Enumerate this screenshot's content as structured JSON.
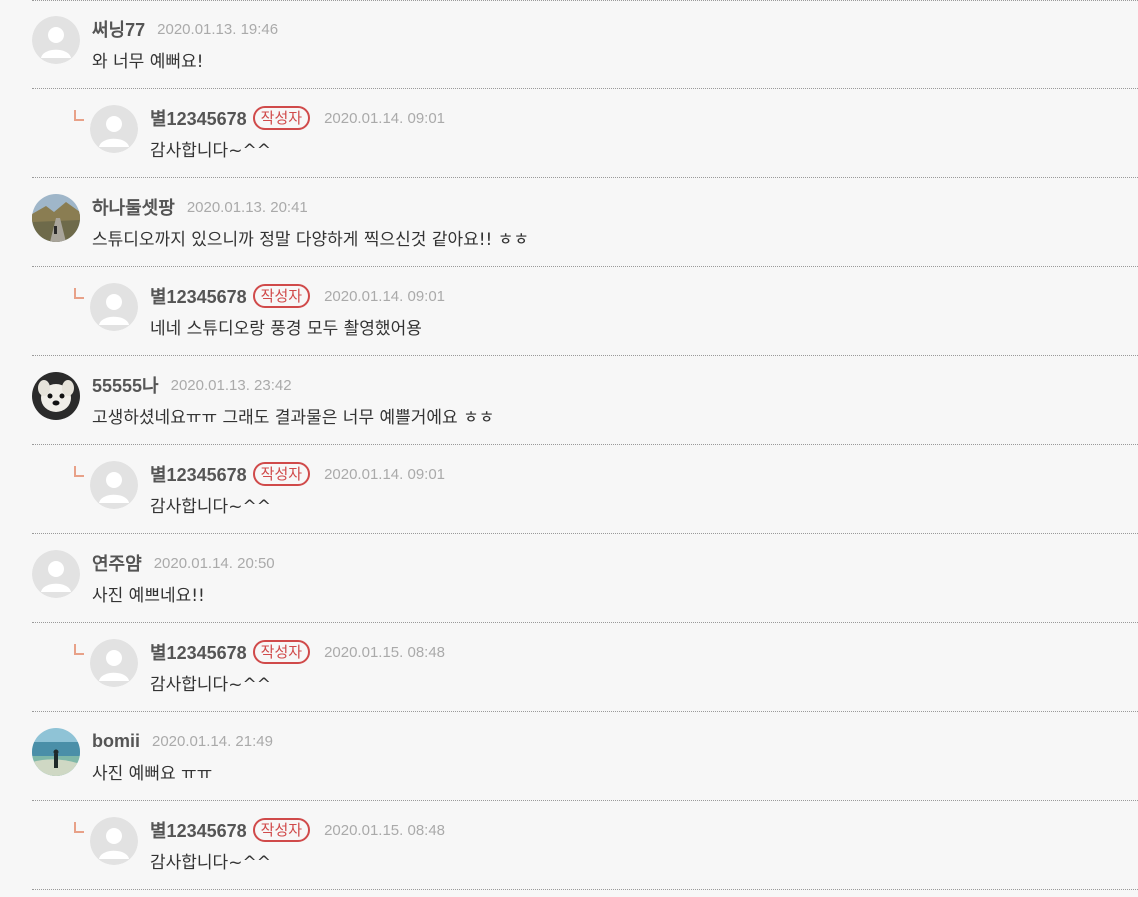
{
  "accent_color": "#d04a4a",
  "reply_mark_color": "#e8a188",
  "comments": [
    {
      "type": "comment",
      "avatar": "default-avatar",
      "nick": "써닝77",
      "date": "2020.01.13. 19:46",
      "text": "와 너무 예뻐요!"
    },
    {
      "type": "reply",
      "avatar": "default-avatar",
      "nick": "별12345678",
      "badge": "작성자",
      "date": "2020.01.14. 09:01",
      "text": "감사합니다~^^"
    },
    {
      "type": "comment",
      "avatar": "landscape-photo-avatar",
      "nick": "하나둘셋팡",
      "date": "2020.01.13. 20:41",
      "text": "스튜디오까지 있으니까 정말 다양하게 찍으신것 같아요!! ㅎㅎ"
    },
    {
      "type": "reply",
      "avatar": "default-avatar",
      "nick": "별12345678",
      "badge": "작성자",
      "date": "2020.01.14. 09:01",
      "text": "네네 스튜디오랑 풍경 모두 촬영했어용"
    },
    {
      "type": "comment",
      "avatar": "dog-photo-avatar",
      "nick": "55555나",
      "date": "2020.01.13. 23:42",
      "text": "고생하셨네요ㅠㅠ 그래도 결과물은 너무 예쁠거에요 ㅎㅎ"
    },
    {
      "type": "reply",
      "avatar": "default-avatar",
      "nick": "별12345678",
      "badge": "작성자",
      "date": "2020.01.14. 09:01",
      "text": "감사합니다~^^"
    },
    {
      "type": "comment",
      "avatar": "default-avatar",
      "nick": "연주얌",
      "date": "2020.01.14. 20:50",
      "text": "사진 예쁘네요!!"
    },
    {
      "type": "reply",
      "avatar": "default-avatar",
      "nick": "별12345678",
      "badge": "작성자",
      "date": "2020.01.15. 08:48",
      "text": "감사합니다~^^"
    },
    {
      "type": "comment",
      "avatar": "beach-photo-avatar",
      "nick": "bomii",
      "date": "2020.01.14. 21:49",
      "text": "사진 예뻐요 ㅠㅠ"
    },
    {
      "type": "reply",
      "avatar": "default-avatar",
      "nick": "별12345678",
      "badge": "작성자",
      "date": "2020.01.15. 08:48",
      "text": "감사합니다~^^"
    }
  ]
}
